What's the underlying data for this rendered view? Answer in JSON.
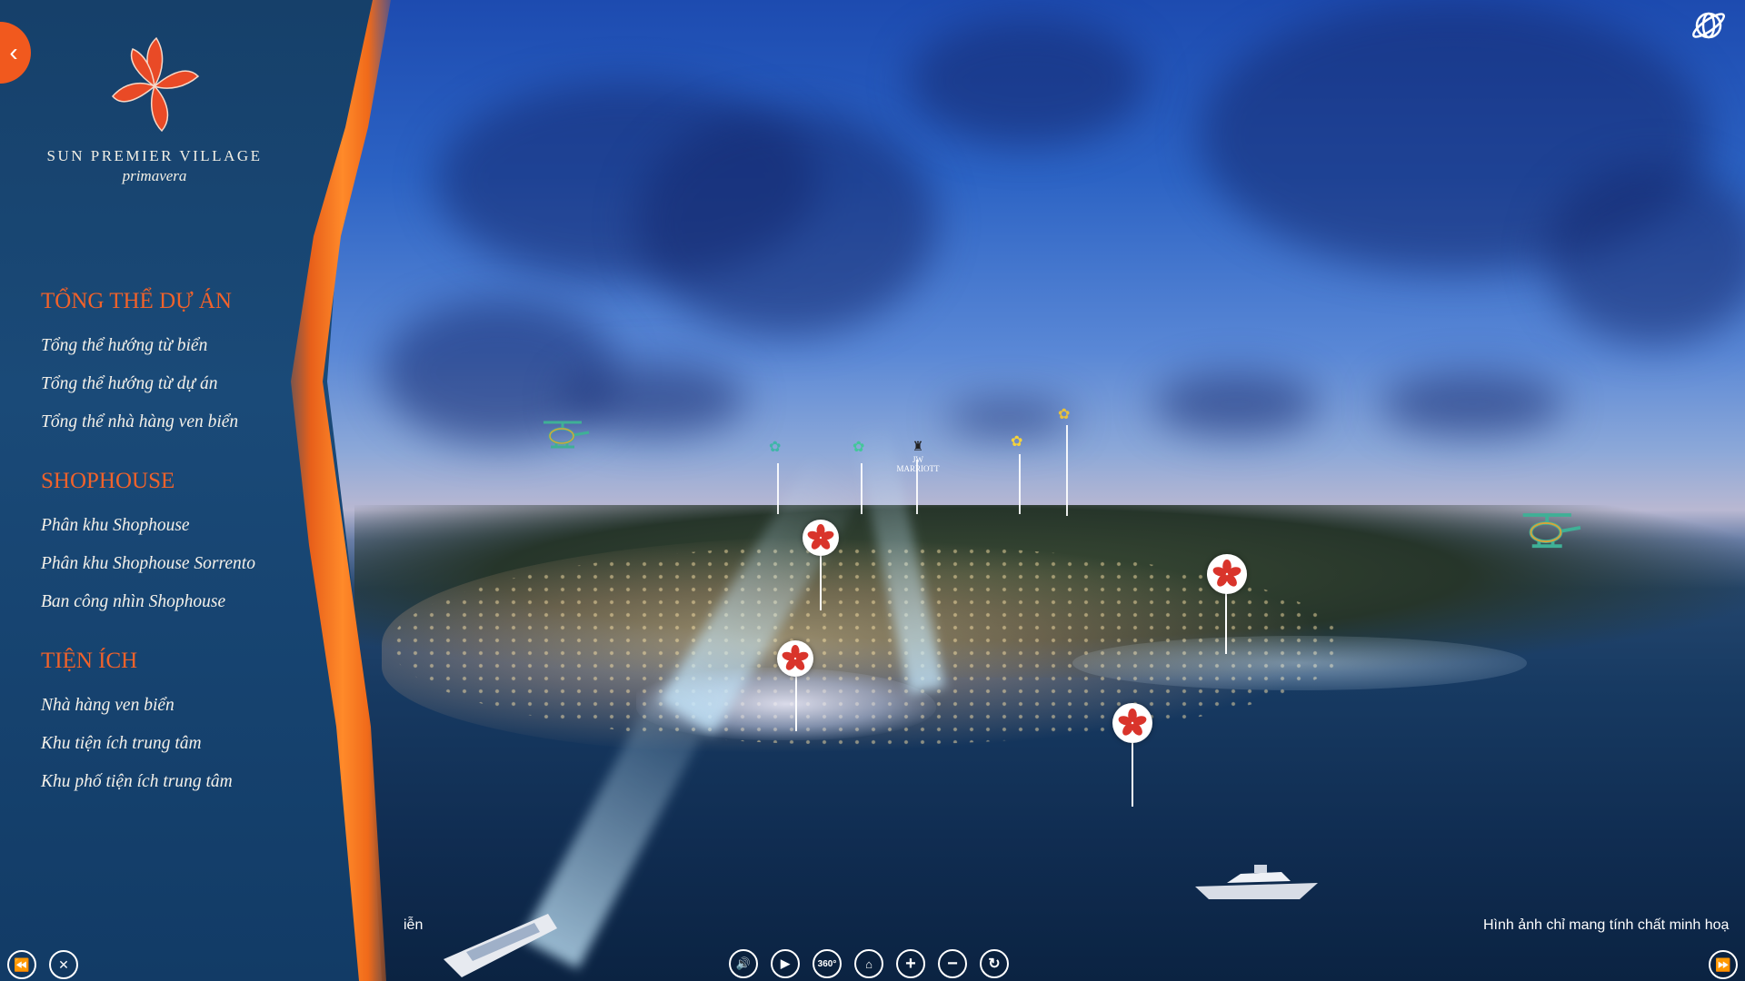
{
  "brand": {
    "name": "SUN PREMIER VILLAGE",
    "subtitle": "primavera"
  },
  "menu": [
    {
      "heading": "TỔNG THỂ DỰ ÁN",
      "items": [
        "Tổng thể hướng từ biển",
        "Tổng thể hướng từ dự án",
        "Tổng thể nhà hàng ven biển"
      ]
    },
    {
      "heading": "SHOPHOUSE",
      "items": [
        "Phân khu Shophouse",
        "Phân khu Shophouse Sorrento",
        "Ban công nhìn Shophouse"
      ]
    },
    {
      "heading": "TIỆN ÍCH",
      "items": [
        "Nhà hàng ven biển",
        "Khu tiện ích trung tâm",
        "Khu phố tiện ích trung tâm"
      ]
    }
  ],
  "scene": {
    "partial_label": "iễn",
    "disclaimer": "Hình ảnh chỉ mang tính chất minh hoạ",
    "brand_label": "JW MARRIOTT"
  },
  "controls": {
    "back_icon": "chevron-left-icon",
    "prev_icon": "rewind-icon",
    "close_icon": "close-icon",
    "next_icon": "fast-forward-icon",
    "view_360_label": "360°",
    "vr_icon": "vr-globe-icon",
    "buttons": [
      "volume-icon",
      "play-icon",
      "360-view-icon",
      "home-icon",
      "zoom-in-icon",
      "zoom-out-icon",
      "rotate-icon"
    ]
  },
  "colors": {
    "accent": "#f1591e",
    "sidebar": "#16406a",
    "marker_flower": "#d9342b"
  }
}
